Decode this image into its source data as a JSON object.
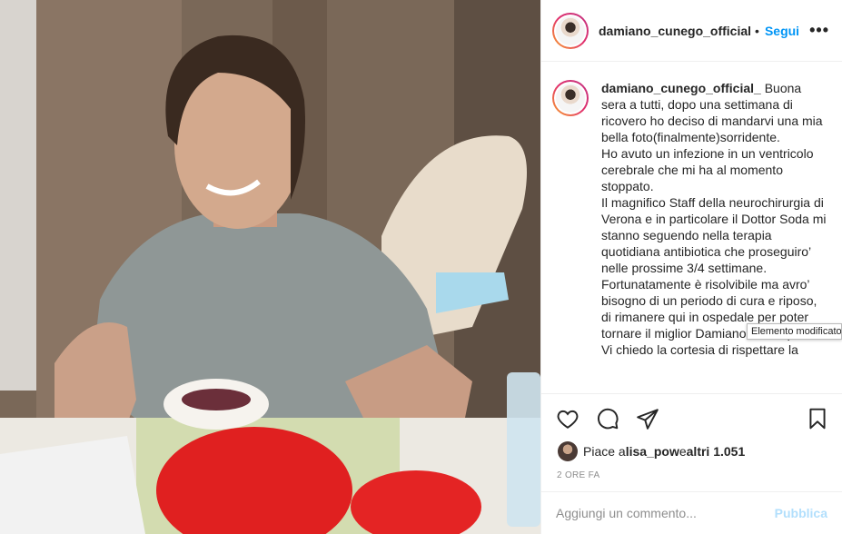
{
  "post": {
    "username": "damiano_cunego_official",
    "dot": "•",
    "follow_label": "Segui",
    "more_label": "•••",
    "caption_user": "damiano_cunego_official_",
    "caption_text": " Buona sera a tutti, dopo una settimana di ricovero ho deciso di mandarvi una mia bella foto(finalmente)sorridente.\nHo avuto un infezione in un ventricolo cerebrale che mi ha al momento stoppato.\nIl magnifico Staff della neurochirurgia di Verona e in particolare il Dottor Soda mi stanno seguendo nella terapia quotidiana antibiotica che proseguiro’ nelle prossime 3/4 settimane.\nFortunatamente è risolvibile ma avro’ bisogno di un periodo di cura e riposo, di rimanere qui in ospedale per poter tornare il miglior Damiano di sempre.\nVi chiedo la cortesia di rispettare la",
    "tooltip": "Elemento modificato",
    "likes_prefix": "Piace a ",
    "likes_user": "lisa_pow",
    "likes_mid": " e ",
    "likes_others": "altri 1.051",
    "time": "2 ORE FA",
    "comment_placeholder": "Aggiungi un commento...",
    "publish_label": "Pubblica",
    "colors": {
      "link": "#0095f6",
      "publish_disabled": "#b2dffc",
      "muted": "#8e8e8e"
    },
    "icons": [
      "heart-icon",
      "comment-icon",
      "share-icon",
      "bookmark-icon",
      "more-icon"
    ]
  }
}
